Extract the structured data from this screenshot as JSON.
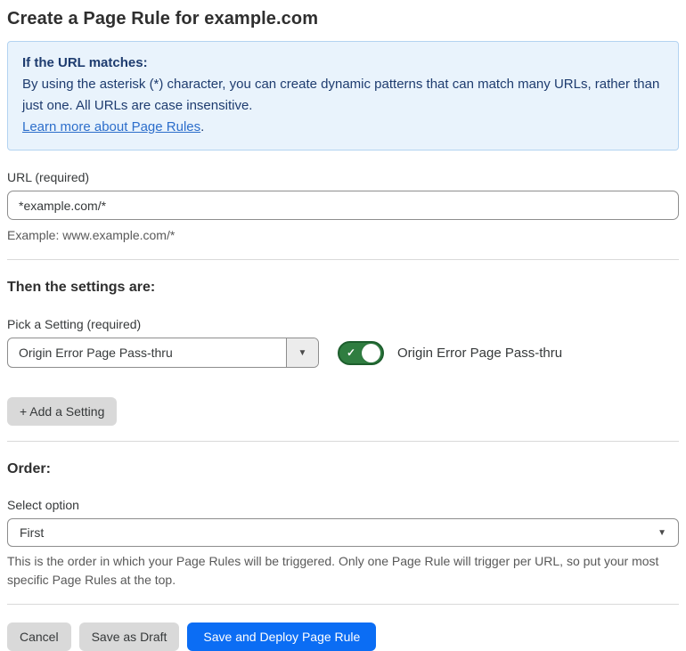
{
  "page": {
    "title": "Create a Page Rule for example.com"
  },
  "info_box": {
    "heading": "If the URL matches:",
    "body": "By using the asterisk (*) character, you can create dynamic patterns that can match many URLs, rather than just one. All URLs are case insensitive.",
    "link_label": "Learn more about Page Rules",
    "link_suffix": "."
  },
  "url_field": {
    "label": "URL (required)",
    "value": "*example.com/*",
    "helper": "Example: www.example.com/*"
  },
  "settings_section": {
    "heading": "Then the settings are:",
    "picker_label": "Pick a Setting (required)",
    "picker_value": "Origin Error Page Pass-thru",
    "toggle_state": "on",
    "toggle_label": "Origin Error Page Pass-thru",
    "add_setting_label": "+ Add a Setting"
  },
  "order_section": {
    "heading": "Order:",
    "select_label": "Select option",
    "select_value": "First",
    "helper": "This is the order in which your Page Rules will be triggered. Only one Page Rule will trigger per URL, so put your most specific Page Rules at the top."
  },
  "footer": {
    "cancel_label": "Cancel",
    "save_draft_label": "Save as Draft",
    "save_deploy_label": "Save and Deploy Page Rule"
  },
  "icons": {
    "caret_down": "▼",
    "check": "✓"
  },
  "colors": {
    "info_background": "#e9f3fc",
    "info_border": "#b3d3f1",
    "info_text": "#1e3c6f",
    "link_blue": "#2c6ecb",
    "toggle_green": "#2f7d40",
    "toggle_green_border": "#1d5e2d",
    "primary_button_blue": "#0b6df4",
    "gray_button": "#d9d9d9",
    "helper_gray": "#595959"
  }
}
